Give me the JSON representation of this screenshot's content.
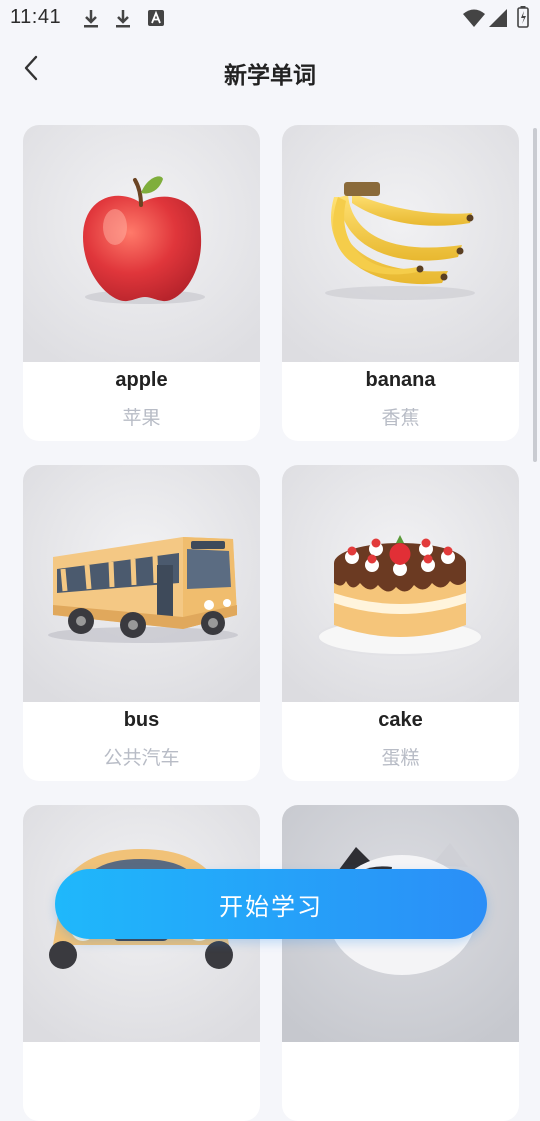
{
  "status_bar": {
    "time": "11:41",
    "icons": [
      "download-icon",
      "download-icon",
      "font-a-icon",
      "wifi-icon",
      "signal-icon",
      "battery-icon"
    ]
  },
  "header": {
    "back_icon": "chevron-left-icon",
    "title": "新学单词"
  },
  "cards": [
    {
      "word": "apple",
      "meaning": "苹果",
      "image": "apple"
    },
    {
      "word": "banana",
      "meaning": "香蕉",
      "image": "banana"
    },
    {
      "word": "bus",
      "meaning": "公共汽车",
      "image": "bus"
    },
    {
      "word": "cake",
      "meaning": "蛋糕",
      "image": "cake"
    },
    {
      "word": "",
      "meaning": "",
      "image": "car"
    },
    {
      "word": "",
      "meaning": "",
      "image": "cat"
    }
  ],
  "start_button": {
    "label": "开始学习"
  },
  "colors": {
    "accent_start": "#1fb8fb",
    "accent_end": "#2b8ef7",
    "meaning_text": "#b8bcc6"
  }
}
